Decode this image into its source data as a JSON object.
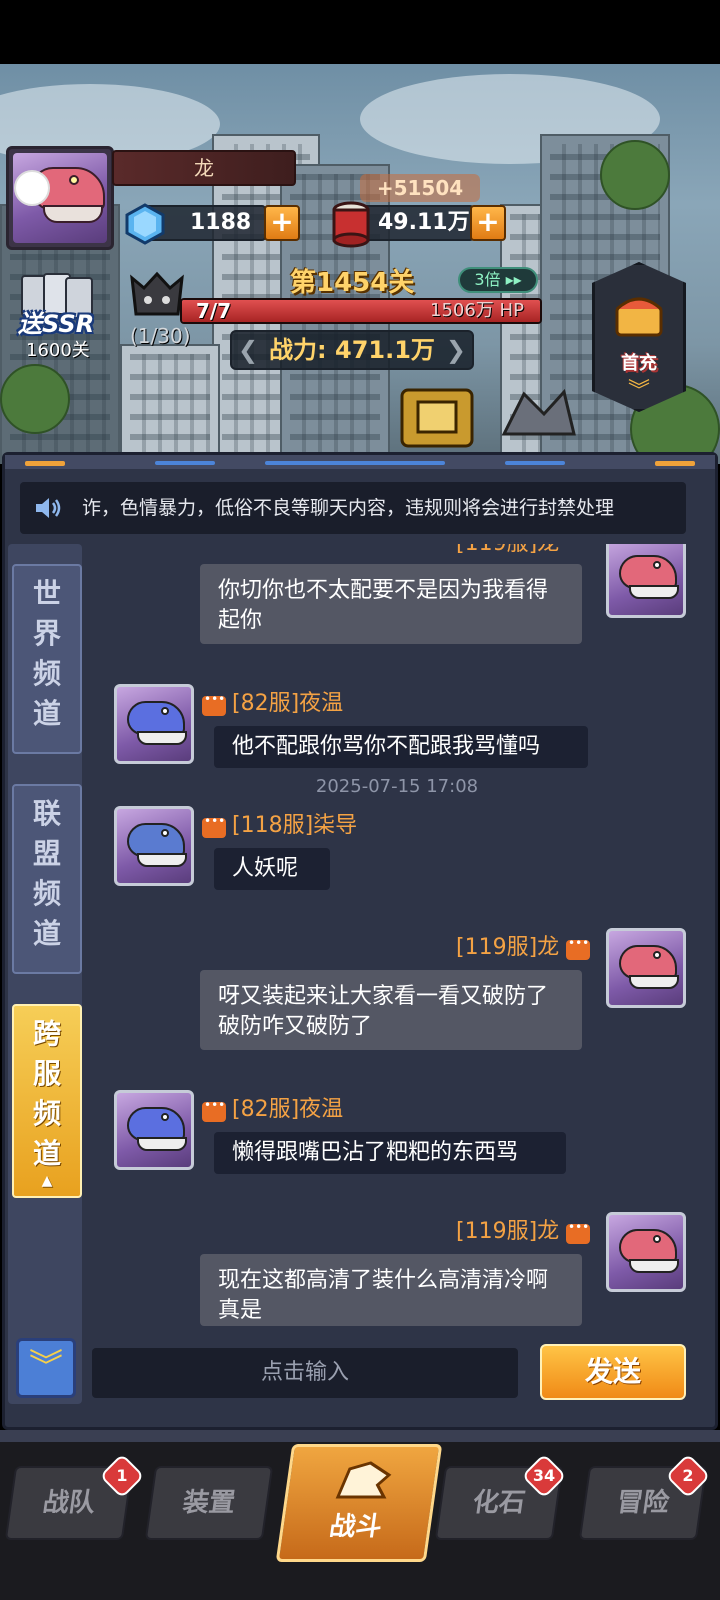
{
  "hud": {
    "player_name": "龙",
    "gems": "1188",
    "gold": "49.11万",
    "gold_gain": "+51504",
    "gift_label": "送SSR",
    "gift_sub": "1600关",
    "boss_count": "(1/30)",
    "level": "第1454关",
    "speed": "3倍",
    "hp_left": "7/7",
    "hp_right": "1506万 HP",
    "hp_fraction": 1.0,
    "power": "战力: 471.1万",
    "first_charge": "首充"
  },
  "notice": {
    "text": "诈，色情暴力，低俗不良等聊天内容，违规则将会进行封禁处理"
  },
  "channels": [
    {
      "chars": [
        "世",
        "界",
        "频",
        "道"
      ],
      "active": false
    },
    {
      "chars": [
        "联",
        "盟",
        "频",
        "道"
      ],
      "active": false
    },
    {
      "chars": [
        "跨",
        "服",
        "频",
        "道"
      ],
      "active": true
    }
  ],
  "messages": {
    "m1": {
      "text_line1": "你切你也不太配要不是因为我看得",
      "text_line2": "起你"
    },
    "m2": {
      "sender": "[82服]夜温",
      "text": "他不配跟你骂你不配跟我骂懂吗"
    },
    "timestamp": "2025-07-15 17:08",
    "m3": {
      "sender": "[118服]柒导",
      "text": "人妖呢"
    },
    "m4": {
      "sender": "[119服]龙",
      "text_line1": "呀又装起来让大家看一看又破防了",
      "text_line2": "破防咋又破防了"
    },
    "m5": {
      "sender": "[82服]夜温",
      "text": "懒得跟嘴巴沾了粑粑的东西骂"
    },
    "m6": {
      "sender": "[119服]龙",
      "text_line1": "现在这都高清了装什么高清清冷啊",
      "text_line2": "真是"
    }
  },
  "input": {
    "placeholder": "点击输入",
    "send_label": "发送"
  },
  "nav": {
    "team": "战队",
    "team_badge": "1",
    "equip": "装置",
    "battle": "战斗",
    "fossil": "化石",
    "fossil_badge": "34",
    "adventure": "冒险",
    "adventure_badge": "2"
  },
  "colors": {
    "accent_orange": "#f4a244",
    "panel_bg": "#2e3447",
    "active_tab": "#f6ce57"
  }
}
